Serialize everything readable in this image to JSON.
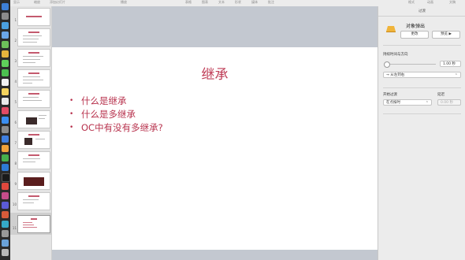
{
  "toolbar": {
    "items": [
      "显示",
      "缩放",
      "添加幻灯片",
      "播放",
      "表格",
      "图表",
      "文本",
      "形状",
      "媒体",
      "批注",
      "格式",
      "动画",
      "文稿"
    ]
  },
  "navigator": {
    "slides": [
      {
        "number": "1"
      },
      {
        "number": "2"
      },
      {
        "number": "3"
      },
      {
        "number": "4"
      },
      {
        "number": "5"
      },
      {
        "number": "6"
      },
      {
        "number": "7"
      },
      {
        "number": "8"
      },
      {
        "number": "9"
      },
      {
        "number": "10"
      },
      {
        "number": "11"
      }
    ],
    "selected_index": 10
  },
  "slide": {
    "title": "继承",
    "bullets": [
      "什么是继承",
      "什么是多继承",
      "OC中有没有多继承?"
    ]
  },
  "inspector": {
    "tab_label": "过渡",
    "effect_name": "对象弹出",
    "change_button": "更改",
    "preview_button": "预览",
    "duration_label": "持续时间与方向",
    "duration_value": "1.00 秒",
    "direction_value": "从左到右",
    "start_label": "开始过渡",
    "start_value": "在点按时",
    "delay_label": "延迟",
    "delay_value": "0.00 秒"
  },
  "colors": {
    "accent": "#bf3c56",
    "slide_bg": "#ffffff",
    "canvas_bg": "#c3c8d0",
    "dock_bg": "#2b2b2b"
  }
}
